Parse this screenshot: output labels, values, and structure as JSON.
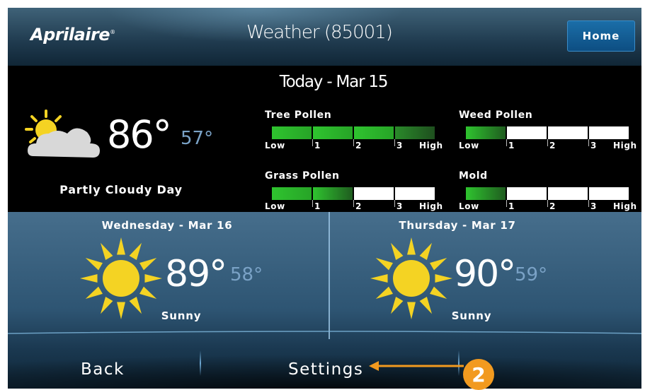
{
  "header": {
    "logo": "Aprilaire",
    "title": "Weather (85001)",
    "home_label": "Home"
  },
  "today": {
    "date": "Today - Mar 15",
    "temp_high": "86°",
    "temp_low": "57°",
    "condition": "Partly Cloudy Day",
    "condition_icon": "partly-cloudy-icon",
    "pollen": [
      {
        "title": "Tree Pollen",
        "level": 4,
        "scale": [
          "Low",
          "1",
          "2",
          "3",
          "High"
        ]
      },
      {
        "title": "Weed Pollen",
        "level": 1,
        "scale": [
          "Low",
          "1",
          "2",
          "3",
          "High"
        ]
      },
      {
        "title": "Grass Pollen",
        "level": 2,
        "scale": [
          "Low",
          "1",
          "2",
          "3",
          "High"
        ]
      },
      {
        "title": "Mold",
        "level": 1,
        "scale": [
          "Low",
          "1",
          "2",
          "3",
          "High"
        ]
      }
    ]
  },
  "forecast": [
    {
      "title": "Wednesday - Mar 16",
      "temp_high": "89°",
      "temp_low": "58°",
      "condition": "Sunny",
      "icon": "sun-icon"
    },
    {
      "title": "Thursday - Mar 17",
      "temp_high": "90°",
      "temp_low": "59°",
      "condition": "Sunny",
      "icon": "sun-icon"
    }
  ],
  "nav": {
    "back_label": "Back",
    "settings_label": "Settings"
  },
  "callout": {
    "number": "2",
    "color": "#f29a1f"
  },
  "colors": {
    "pollen_green": "#2fc42f",
    "low_temp": "#7aa2c6",
    "home_button": "#1b6ea8"
  }
}
